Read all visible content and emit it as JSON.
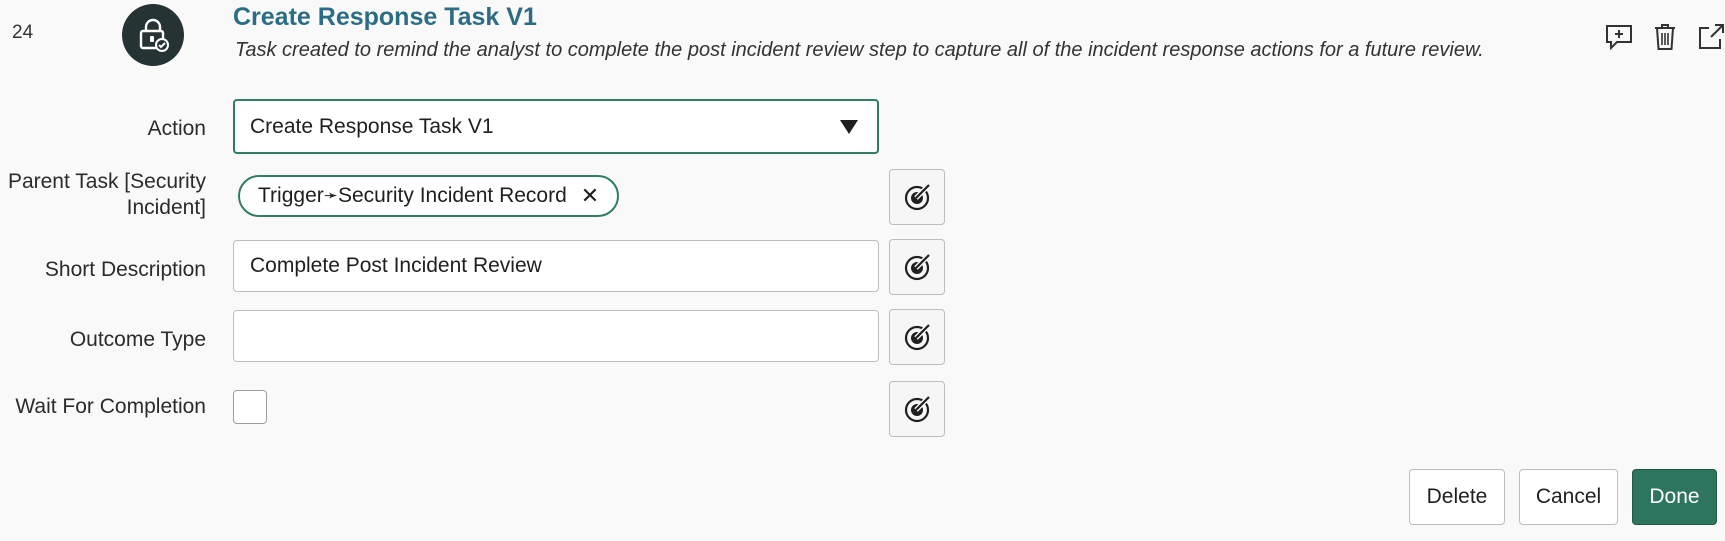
{
  "step": {
    "number": "24",
    "title": "Create Response Task V1",
    "description": "Task created to remind the analyst to complete the post incident review step to capture all of the incident response actions for a future review.",
    "icon": "lock-shield-icon"
  },
  "header_actions": {
    "add_comment_icon": "add-comment-icon",
    "delete_icon": "trash-icon",
    "open_icon": "open-external-icon"
  },
  "form": {
    "action": {
      "label": "Action",
      "value": "Create Response Task V1"
    },
    "parent_task": {
      "label_line1": "Parent Task [Security",
      "label_line2": "Incident]",
      "pill_part1": "Trigger",
      "pill_arrow": "➛",
      "pill_part2": "Security Incident Record",
      "remove": "✕"
    },
    "short_description": {
      "label": "Short Description",
      "value": "Complete Post Incident Review"
    },
    "outcome_type": {
      "label": "Outcome Type",
      "value": ""
    },
    "wait_for_completion": {
      "label": "Wait For Completion",
      "checked": false
    }
  },
  "buttons": {
    "delete": "Delete",
    "cancel": "Cancel",
    "done": "Done"
  },
  "colors": {
    "accent": "#2e7d66",
    "title": "#2a6d85",
    "primary_button": "#2e7560",
    "icon_circle": "#263335"
  }
}
